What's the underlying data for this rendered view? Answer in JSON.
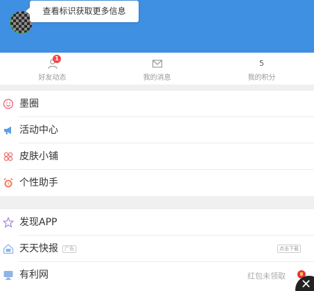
{
  "header": {
    "tooltip": "查看标识获取更多信息"
  },
  "stats": [
    {
      "label": "好友动态",
      "badge": "1",
      "icon": "user-icon"
    },
    {
      "label": "我的消息",
      "icon": "mail-icon"
    },
    {
      "label": "我的积分",
      "value": "5"
    }
  ],
  "menu_group_1": [
    {
      "label": "墨圈",
      "icon": "smile-icon"
    },
    {
      "label": "活动中心",
      "icon": "megaphone-icon"
    },
    {
      "label": "皮肤小铺",
      "icon": "clover-icon"
    },
    {
      "label": "个性助手",
      "icon": "alarm-icon"
    }
  ],
  "menu_group_2": [
    {
      "label": "发现APP",
      "icon": "star-icon"
    },
    {
      "label": "天天快报",
      "tag": "广告",
      "action": "点击下载",
      "icon": "ad-icon"
    },
    {
      "label": "有利网",
      "right_text": "红包未领取",
      "icon": "monitor-icon"
    }
  ],
  "colors": {
    "header": "#3f8fe3",
    "badge": "#f2484b",
    "accent_pink": "#f06b7c",
    "accent_blue": "#5b9fe6"
  }
}
